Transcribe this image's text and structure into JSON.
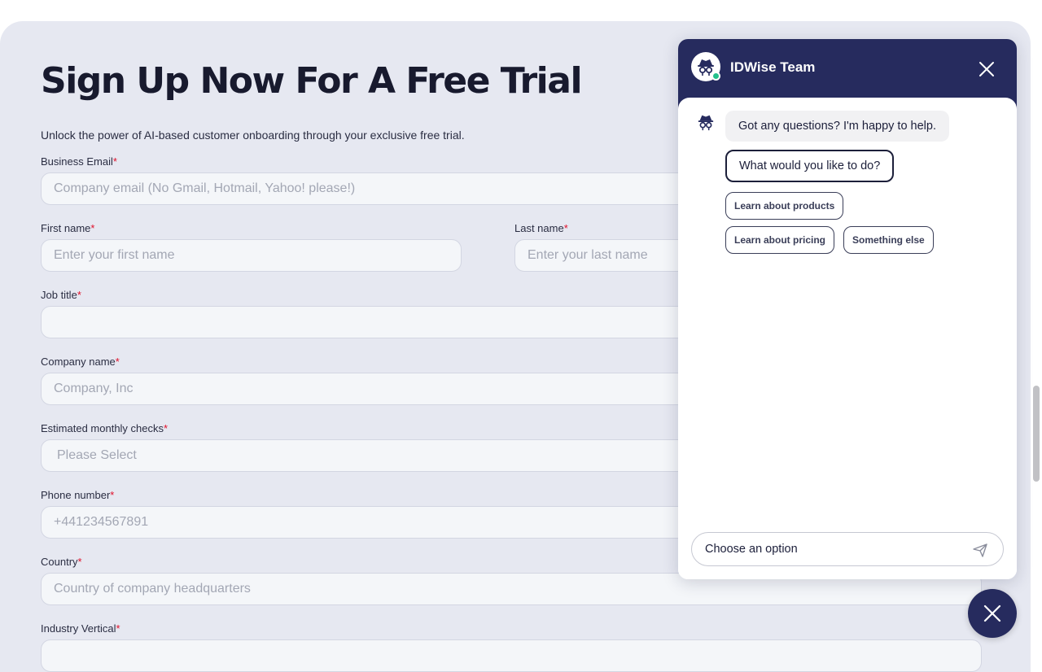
{
  "form": {
    "title": "Sign Up Now For A Free Trial",
    "subtitle": "Unlock the power of AI-based customer onboarding through your exclusive free trial.",
    "required_mark": "*",
    "fields": {
      "business_email": {
        "label": "Business Email",
        "placeholder": "Company email (No Gmail, Hotmail, Yahoo! please!)",
        "value": ""
      },
      "first_name": {
        "label": "First name",
        "placeholder": "Enter your first name",
        "value": ""
      },
      "last_name": {
        "label": "Last name",
        "placeholder": "Enter your last name",
        "value": ""
      },
      "job_title": {
        "label": "Job title",
        "placeholder": "",
        "value": ""
      },
      "company_name": {
        "label": "Company name",
        "placeholder": "Company, Inc",
        "value": ""
      },
      "monthly_checks": {
        "label": "Estimated monthly checks",
        "selected": "Please Select"
      },
      "phone_number": {
        "label": "Phone number",
        "placeholder": "+441234567891",
        "value": ""
      },
      "country": {
        "label": "Country",
        "placeholder": "Country of company headquarters",
        "value": ""
      },
      "industry_vertical": {
        "label": "Industry Vertical"
      }
    }
  },
  "chat": {
    "title": "IDWise Team",
    "status": "online",
    "messages": [
      {
        "from": "bot",
        "text": "Got any questions? I'm happy to help."
      },
      {
        "from": "bot",
        "text": "What would you like to do?"
      }
    ],
    "options": [
      "Learn about products",
      "Learn about pricing",
      "Something else"
    ],
    "input_placeholder": "Choose an option",
    "icons": {
      "avatar": "bot-detective-icon",
      "close": "close-icon",
      "send": "send-icon",
      "launcher": "close-icon"
    }
  },
  "colors": {
    "page_background": "#e6e8f1",
    "chat_header": "#262b5e",
    "required": "#e0112b",
    "online": "#22c08a"
  }
}
